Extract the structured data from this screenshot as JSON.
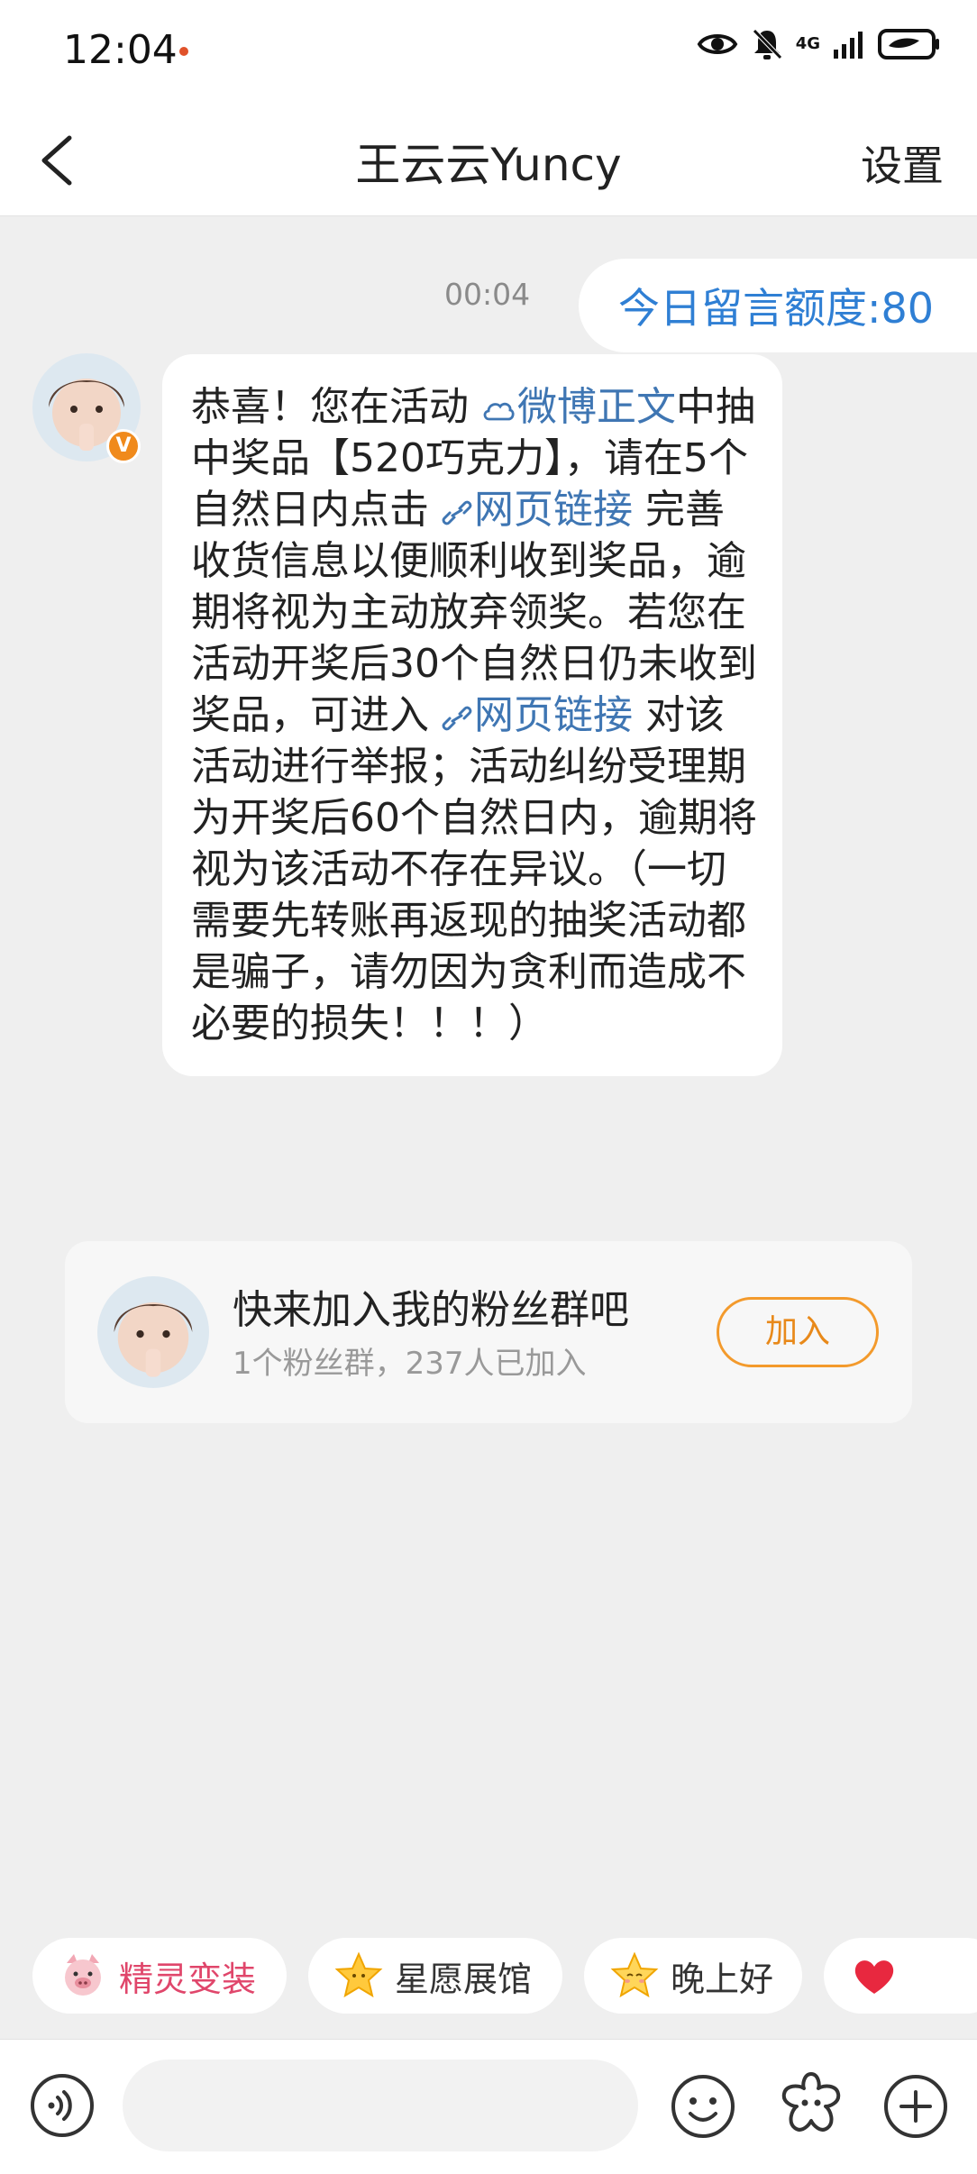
{
  "status_bar": {
    "time": "12:04",
    "network": "4G"
  },
  "header": {
    "title": "王云云Yuncy",
    "settings_label": "设置"
  },
  "chat": {
    "timestamp": "00:04",
    "quota_message": "今日留言额度:80",
    "message_parts": {
      "p1": "恭喜！您在活动 ",
      "link_weibo": "微博正文",
      "p2": "中抽中奖品【520巧克力】，请在5个自然日内点击 ",
      "link_web1": "网页链接",
      "p3": " 完善收货信息以便顺利收到奖品，逾期将视为主动放弃领奖。若您在活动开奖后30个自然日仍未收到奖品，可进入 ",
      "link_web2": "网页链接",
      "p4": " 对该活动进行举报；活动纠纷受理期为开奖后60个自然日内，逾期将视为该活动不存在异议。（一切需要先转账再返现的抽奖活动都是骗子，请勿因为贪利而造成不必要的损失！！！）"
    },
    "verified_badge": "V"
  },
  "fan_group": {
    "title": "快来加入我的粉丝群吧",
    "subtitle": "1个粉丝群，237人已加入",
    "join_label": "加入"
  },
  "quick_chips": [
    {
      "label": "精灵变装",
      "icon": "pig-icon"
    },
    {
      "label": "星愿展馆",
      "icon": "star-icon"
    },
    {
      "label": "晚上好",
      "icon": "star-face-icon"
    },
    {
      "label": "",
      "icon": "heart-icon"
    }
  ],
  "input_bar": {
    "placeholder": ""
  },
  "colors": {
    "link": "#3f76b3",
    "quota_text": "#2f7fd4",
    "accent_orange": "#f39a2c",
    "chat_background": "#efefef"
  }
}
